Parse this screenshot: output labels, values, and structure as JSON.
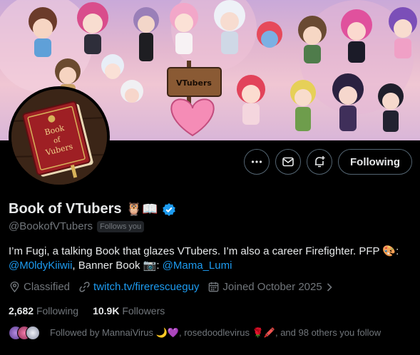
{
  "banner": {
    "sign_text": "VTubers"
  },
  "avatar": {
    "book_title_lines": [
      "Book",
      "of",
      "Vubers"
    ]
  },
  "actions": {
    "more_label": "More",
    "message_label": "Message",
    "notify_label": "Notify",
    "following_label": "Following"
  },
  "profile": {
    "display_name": "Book of VTubers",
    "name_emoji": "🦉📖",
    "handle": "@BookofVTubers",
    "follows_you": "Follows you",
    "bio": {
      "line1_text": "I’m Fugi, a talking Book that glazes VTubers. I’m also a career Firefighter. PFP 🎨:",
      "line2_link1": "@M0ldyKiiwii",
      "line2_mid": ", Banner Book 📷: ",
      "line2_link2": "@Mama_Lumi"
    },
    "location": "Classified",
    "website": "twitch.tv/firerescueguy",
    "joined": "Joined October 2025"
  },
  "stats": {
    "following_count": "2,682",
    "following_label": "Following",
    "followers_count": "10.9K",
    "followers_label": "Followers"
  },
  "followed_by": {
    "text": "Followed by MannaiVirus 🌙💜, rosedoodlevirus 🌹🖍️, and 98 others you follow"
  },
  "colors": {
    "accent": "#1d9bf0",
    "muted": "#71767b",
    "text": "#e7e9ea",
    "border": "#536471"
  }
}
